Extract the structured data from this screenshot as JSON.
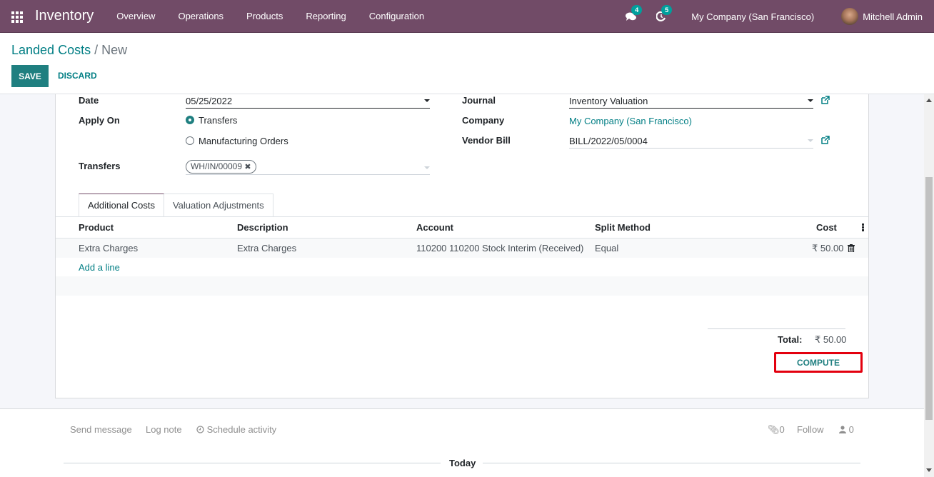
{
  "navbar": {
    "app_name": "Inventory",
    "menu": [
      "Overview",
      "Operations",
      "Products",
      "Reporting",
      "Configuration"
    ],
    "messages_count": "4",
    "activities_count": "5",
    "company": "My Company (San Francisco)",
    "user": "Mitchell Admin",
    "icons": {
      "apps": "apps-grid-icon",
      "messages": "chat-bubbles-icon",
      "activities": "clock-icon"
    }
  },
  "control_panel": {
    "breadcrumb_parent": "Landed Costs",
    "breadcrumb_separator": " / ",
    "breadcrumb_current": "New",
    "save_label": "SAVE",
    "discard_label": "DISCARD"
  },
  "form": {
    "date": {
      "label": "Date",
      "value": "05/25/2022"
    },
    "apply_on": {
      "label": "Apply On",
      "options": [
        "Transfers",
        "Manufacturing Orders"
      ],
      "selected": "Transfers"
    },
    "transfers": {
      "label": "Transfers",
      "tags": [
        "WH/IN/00009"
      ]
    },
    "journal": {
      "label": "Journal",
      "value": "Inventory Valuation"
    },
    "company": {
      "label": "Company",
      "value": "My Company (San Francisco)"
    },
    "vendor_bill": {
      "label": "Vendor Bill",
      "value": "BILL/2022/05/0004"
    }
  },
  "tabs": [
    "Additional Costs",
    "Valuation Adjustments"
  ],
  "active_tab": "Additional Costs",
  "cost_table": {
    "columns": [
      "Product",
      "Description",
      "Account",
      "Split Method",
      "Cost"
    ],
    "rows": [
      {
        "product": "Extra Charges",
        "description": "Extra Charges",
        "account": "110200 110200 Stock Interim (Received)",
        "split_method": "Equal",
        "cost": "₹ 50.00"
      }
    ],
    "add_line_label": "Add a line"
  },
  "totals": {
    "label": "Total:",
    "value": "₹ 50.00"
  },
  "compute_label": "COMPUTE",
  "chatter": {
    "send_message": "Send message",
    "log_note": "Log note",
    "schedule_activity": "Schedule activity",
    "attachments_count": "0",
    "follow": "Follow",
    "followers_count": "0",
    "today": "Today"
  },
  "colors": {
    "navbar": "#714b67",
    "primary": "#1f7f80",
    "link": "#017e84",
    "highlight_box": "#e3000e",
    "badge": "#00a09d"
  }
}
